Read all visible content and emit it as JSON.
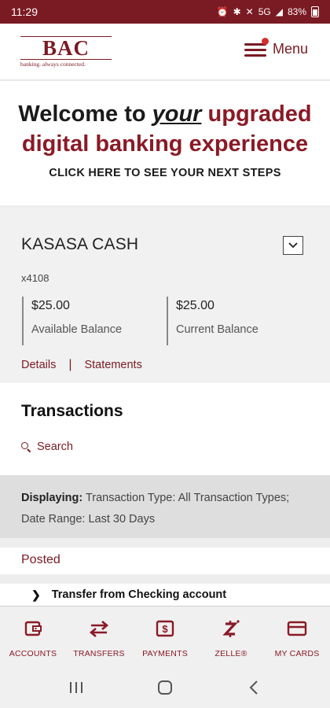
{
  "status_bar": {
    "time": "11:29",
    "network": "5G",
    "battery": "83%"
  },
  "header": {
    "logo_text": "BAC",
    "logo_tagline": "banking. always connected.",
    "menu_label": "Menu"
  },
  "banner": {
    "line1_prefix": "Welcome to",
    "line1_em": "your",
    "line1_suffix": "upgraded",
    "line2": "digital banking experience",
    "cta": "CLICK HERE TO SEE YOUR NEXT STEPS"
  },
  "account": {
    "name": "KASASA CASH",
    "number": "x4108",
    "available_value": "$25.00",
    "available_label": "Available Balance",
    "current_value": "$25.00",
    "current_label": "Current Balance",
    "details_link": "Details",
    "statements_link": "Statements"
  },
  "transactions": {
    "title": "Transactions",
    "search_label": "Search",
    "filter_label": "Displaying:",
    "filter_text": "Transaction Type: All Transaction Types; Date Range: Last 30 Days",
    "posted_label": "Posted",
    "items": [
      {
        "description": "Transfer from Checking account"
      }
    ]
  },
  "bottom_nav": [
    {
      "label": "ACCOUNTS",
      "icon": "wallet-icon"
    },
    {
      "label": "TRANSFERS",
      "icon": "transfer-arrows-icon"
    },
    {
      "label": "PAYMENTS",
      "icon": "payments-icon"
    },
    {
      "label": "ZELLE®",
      "icon": "zelle-icon"
    },
    {
      "label": "MY CARDS",
      "icon": "card-icon"
    }
  ],
  "colors": {
    "brand": "#7a1a22",
    "accent": "#8a1a26"
  }
}
